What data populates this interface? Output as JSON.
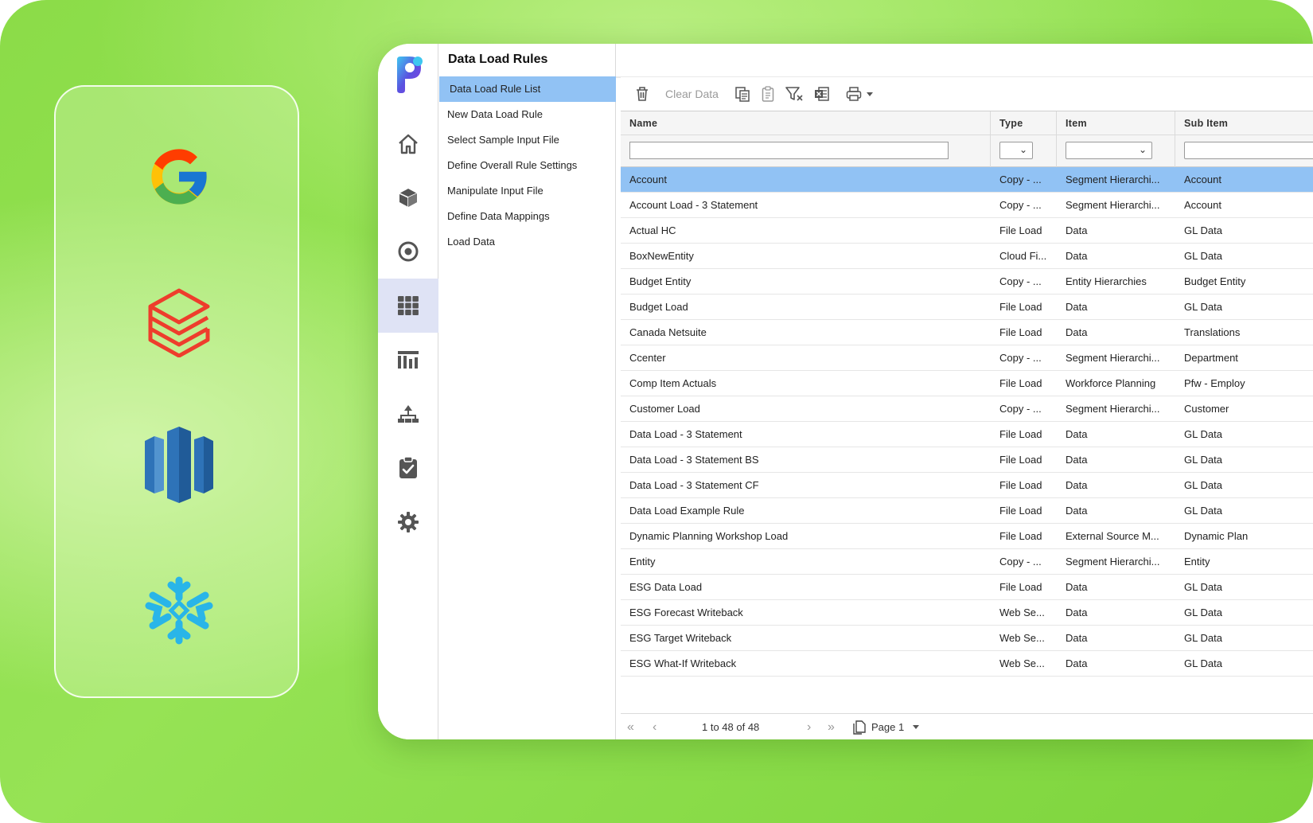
{
  "app": {
    "page_title": "Data Load Rules",
    "steps": [
      {
        "label": "Data Load Rule List",
        "active": true
      },
      {
        "label": "New Data Load Rule",
        "active": false
      },
      {
        "label": "Select Sample Input File",
        "active": false
      },
      {
        "label": "Define Overall Rule Settings",
        "active": false
      },
      {
        "label": "Manipulate Input File",
        "active": false
      },
      {
        "label": "Define Data Mappings",
        "active": false
      },
      {
        "label": "Load Data",
        "active": false
      }
    ],
    "rail_icons": [
      "home-icon",
      "cube-icon",
      "target-icon",
      "grid-icon",
      "reports-icon",
      "hierarchy-icon",
      "clipboard-check-icon",
      "settings-icon"
    ],
    "active_rail": "grid-icon"
  },
  "toolbar": {
    "clear_data_label": "Clear Data"
  },
  "grid": {
    "columns": [
      "Name",
      "Type",
      "Item",
      "Sub Item"
    ],
    "rows": [
      [
        "Account",
        "Copy - ...",
        "Segment Hierarchi...",
        "Account"
      ],
      [
        "Account Load - 3 Statement",
        "Copy - ...",
        "Segment Hierarchi...",
        "Account"
      ],
      [
        "Actual HC",
        "File Load",
        "Data",
        "GL Data"
      ],
      [
        "BoxNewEntity",
        "Cloud Fi...",
        "Data",
        "GL Data"
      ],
      [
        "Budget Entity",
        "Copy - ...",
        "Entity Hierarchies",
        "Budget Entity"
      ],
      [
        "Budget Load",
        "File Load",
        "Data",
        "GL Data"
      ],
      [
        "Canada Netsuite",
        "File Load",
        "Data",
        "Translations"
      ],
      [
        "Ccenter",
        "Copy - ...",
        "Segment Hierarchi...",
        "Department"
      ],
      [
        "Comp Item Actuals",
        "File Load",
        "Workforce Planning",
        "Pfw - Employ"
      ],
      [
        "Customer Load",
        "Copy - ...",
        "Segment Hierarchi...",
        "Customer"
      ],
      [
        "Data Load - 3 Statement",
        "File Load",
        "Data",
        "GL Data"
      ],
      [
        "Data Load - 3 Statement BS",
        "File Load",
        "Data",
        "GL Data"
      ],
      [
        "Data Load - 3 Statement CF",
        "File Load",
        "Data",
        "GL Data"
      ],
      [
        "Data Load Example Rule",
        "File Load",
        "Data",
        "GL Data"
      ],
      [
        "Dynamic Planning Workshop Load",
        "File Load",
        "External Source M...",
        "Dynamic Plan"
      ],
      [
        "Entity",
        "Copy - ...",
        "Segment Hierarchi...",
        "Entity"
      ],
      [
        "ESG Data Load",
        "File Load",
        "Data",
        "GL Data"
      ],
      [
        "ESG Forecast Writeback",
        "Web Se...",
        "Data",
        "GL Data"
      ],
      [
        "ESG Target Writeback",
        "Web Se...",
        "Data",
        "GL Data"
      ],
      [
        "ESG What-If Writeback",
        "Web Se...",
        "Data",
        "GL Data"
      ]
    ],
    "selected_row": 0
  },
  "pager": {
    "summary": "1 to 48 of 48",
    "page_label": "Page 1"
  },
  "colors": {
    "background": "#8bdc48",
    "selected": "#91c2f4",
    "rail_active": "#dfe3f5"
  },
  "brands": [
    "google-logo",
    "databricks-logo",
    "amazon-redshift-logo",
    "snowflake-logo"
  ]
}
